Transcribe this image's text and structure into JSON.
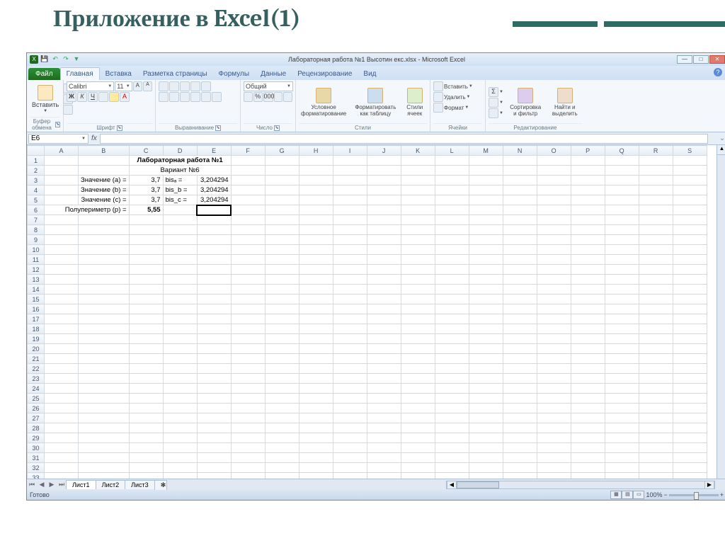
{
  "slide_title": "Приложение в Excel(1)",
  "titlebar": {
    "doc": "Лабораторная работа №1 Высотин екс.xlsx - Microsoft Excel"
  },
  "tabs": {
    "file": "Файл",
    "t1": "Главная",
    "t2": "Вставка",
    "t3": "Разметка страницы",
    "t4": "Формулы",
    "t5": "Данные",
    "t6": "Рецензирование",
    "t7": "Вид"
  },
  "ribbon": {
    "paste": "Вставить",
    "clipboard": "Буфер обмена",
    "font_name": "Calibri",
    "font_size": "11",
    "font": "Шрифт",
    "align": "Выравнивание",
    "number_format": "Общий",
    "number": "Число",
    "cond_fmt": "Условное форматирование",
    "fmt_table": "Форматировать как таблицу",
    "cell_styles": "Стили ячеек",
    "styles": "Стили",
    "insert": "Вставить",
    "delete": "Удалить",
    "format": "Формат",
    "cells": "Ячейки",
    "sort": "Сортировка и фильтр",
    "find": "Найти и выделить",
    "editing": "Редактирование"
  },
  "namebox": "E6",
  "cols": [
    "A",
    "B",
    "C",
    "D",
    "E",
    "F",
    "G",
    "H",
    "I",
    "J",
    "K",
    "L",
    "M",
    "N",
    "O",
    "P",
    "Q",
    "R",
    "S"
  ],
  "cells": {
    "r1_title": "Лабораторная работа №1",
    "r2_variant": "Вариант №6",
    "r3_b": "Значение (a) =",
    "r3_c": "3,7",
    "r3_d": "bisₐ =",
    "r3_e": "3,204294",
    "r4_b": "Значение (b) =",
    "r4_c": "3,7",
    "r4_d": "bis_b =",
    "r4_e": "3,204294",
    "r5_b": "Значение (c) =",
    "r5_c": "3,7",
    "r5_d": "bis_c =",
    "r5_e": "3,204294",
    "r6_a": "Полупериметр (p) =",
    "r6_c": "5,55"
  },
  "sheets": {
    "s1": "Лист1",
    "s2": "Лист2",
    "s3": "Лист3"
  },
  "status": {
    "ready": "Готово",
    "zoom": "100%"
  }
}
